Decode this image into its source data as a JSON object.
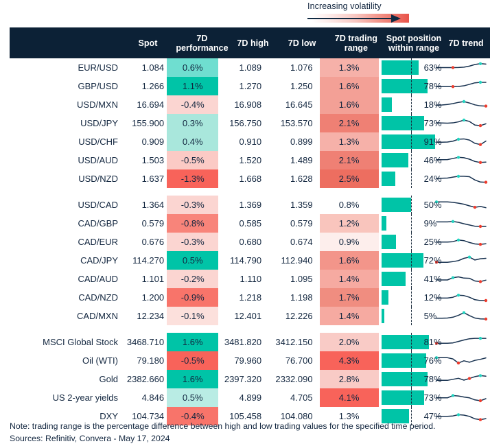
{
  "legend": {
    "volatility_label": "Increasing volatility",
    "gradient_from": "#ffffff",
    "gradient_to": "#e8544a",
    "arrow_color": "#102a43"
  },
  "header": {
    "bg": "#0c2136",
    "columns": [
      {
        "key": "label",
        "label": ""
      },
      {
        "key": "spot",
        "label": "Spot"
      },
      {
        "key": "perf",
        "label": "7D performance"
      },
      {
        "key": "high",
        "label": "7D high"
      },
      {
        "key": "low",
        "label": "7D low"
      },
      {
        "key": "range",
        "label": "7D trading range"
      },
      {
        "key": "pos",
        "label": "Spot position within range"
      },
      {
        "key": "trend",
        "label": "7D trend"
      }
    ]
  },
  "colors": {
    "positive_strong": "#00c4a7",
    "positive_mid": "#62dcc8",
    "positive_light": "#b9ece4",
    "negative_strong": "#f9635a",
    "negative_mid": "#f8a79f",
    "negative_light": "#fbd6d2",
    "negative_faint": "#fdeeec",
    "bar": "#00c4a7",
    "spark_line": "#17314f",
    "spark_high_dot": "#23d3c0",
    "spark_low_dot": "#ef3b2c",
    "text": "#12263f"
  },
  "blocks": [
    {
      "name": "usd-pairs",
      "rows": [
        {
          "label": "EUR/USD",
          "spot": "1.084",
          "perf": "0.6%",
          "perf_bg": "#6fded0",
          "high": "1.089",
          "low": "1.076",
          "range": "1.3%",
          "range_bg": "#f6b1a9",
          "pos_pct": "63%",
          "pos_value": 63,
          "spark": [
            0.5,
            0.5,
            0.5,
            0.5,
            0.49,
            0.46,
            0.36,
            0.2,
            0.12,
            0.16
          ],
          "spark_high_idx": 8,
          "spark_low_idx": 3
        },
        {
          "label": "GBP/USD",
          "spot": "1.266",
          "perf": "1.1%",
          "perf_bg": "#00c4a7",
          "high": "1.270",
          "low": "1.250",
          "range": "1.6%",
          "range_bg": "#f3a096",
          "pos_pct": "78%",
          "pos_value": 78,
          "spark": [
            0.55,
            0.55,
            0.55,
            0.55,
            0.53,
            0.47,
            0.33,
            0.18,
            0.13,
            0.13
          ],
          "spark_high_idx": 8,
          "spark_low_idx": 3
        },
        {
          "label": "USD/MXN",
          "spot": "16.694",
          "perf": "-0.4%",
          "perf_bg": "#fbd5d1",
          "high": "16.908",
          "low": "16.645",
          "range": "1.6%",
          "range_bg": "#f3a096",
          "pos_pct": "18%",
          "pos_value": 18,
          "spark": [
            0.56,
            0.53,
            0.48,
            0.4,
            0.28,
            0.2,
            0.34,
            0.52,
            0.62,
            0.64
          ],
          "spark_high_idx": 5,
          "spark_low_idx": 9
        },
        {
          "label": "USD/JPY",
          "spot": "155.900",
          "perf": "0.3%",
          "perf_bg": "#a9e7dc",
          "high": "156.750",
          "low": "153.570",
          "range": "2.1%",
          "range_bg": "#ef8074",
          "pos_pct": "73%",
          "pos_value": 73,
          "spark": [
            0.46,
            0.48,
            0.5,
            0.47,
            0.37,
            0.2,
            0.33,
            0.68,
            0.74,
            0.56
          ],
          "spark_high_idx": 5,
          "spark_low_idx": 8
        },
        {
          "label": "USD/CHF",
          "spot": "0.909",
          "perf": "0.4%",
          "perf_bg": "#a9e7dc",
          "high": "0.910",
          "low": "0.899",
          "range": "1.3%",
          "range_bg": "#f6b1a9",
          "pos_pct": "91%",
          "pos_value": 91,
          "spark": [
            0.55,
            0.55,
            0.53,
            0.45,
            0.26,
            0.23,
            0.34,
            0.66,
            0.78,
            0.44
          ],
          "spark_high_idx": 4,
          "spark_low_idx": 8
        },
        {
          "label": "USD/AUD",
          "spot": "1.503",
          "perf": "-0.5%",
          "perf_bg": "#fbcac5",
          "high": "1.520",
          "low": "1.489",
          "range": "2.1%",
          "range_bg": "#ef8074",
          "pos_pct": "46%",
          "pos_value": 46,
          "spark": [
            0.45,
            0.45,
            0.44,
            0.33,
            0.22,
            0.26,
            0.4,
            0.62,
            0.72,
            0.68
          ],
          "spark_high_idx": 4,
          "spark_low_idx": 8
        },
        {
          "label": "USD/NZD",
          "spot": "1.637",
          "perf": "-1.3%",
          "perf_bg": "#f8635a",
          "high": "1.668",
          "low": "1.628",
          "range": "2.5%",
          "range_bg": "#ed6e60",
          "pos_pct": "24%",
          "pos_value": 24,
          "spark": [
            0.46,
            0.45,
            0.43,
            0.34,
            0.26,
            0.26,
            0.3,
            0.62,
            0.82,
            0.84
          ],
          "spark_high_idx": 4,
          "spark_low_idx": 9
        }
      ]
    },
    {
      "name": "cad-pairs",
      "rows": [
        {
          "label": "USD/CAD",
          "spot": "1.364",
          "perf": "-0.3%",
          "perf_bg": "#fbd5d1",
          "high": "1.369",
          "low": "1.359",
          "range": "0.8%",
          "range_bg": "#ffffff",
          "pos_pct": "50%",
          "pos_value": 50,
          "spark": [
            0.22,
            0.22,
            0.22,
            0.26,
            0.34,
            0.44,
            0.6,
            0.74,
            0.66,
            0.78
          ],
          "spark_high_idx": 0,
          "spark_low_idx": 7
        },
        {
          "label": "CAD/GBP",
          "spot": "0.579",
          "perf": "-0.8%",
          "perf_bg": "#f8847a",
          "high": "0.585",
          "low": "0.579",
          "range": "1.2%",
          "range_bg": "#f9c5bd",
          "pos_pct": "9%",
          "pos_value": 9,
          "spark": [
            0.36,
            0.36,
            0.36,
            0.32,
            0.4,
            0.54,
            0.66,
            0.78,
            0.8,
            0.8
          ],
          "spark_high_idx": 3,
          "spark_low_idx": 8
        },
        {
          "label": "CAD/EUR",
          "spot": "0.676",
          "perf": "-0.3%",
          "perf_bg": "#fbd5d1",
          "high": "0.680",
          "low": "0.674",
          "range": "0.9%",
          "range_bg": "#fdeeec",
          "pos_pct": "25%",
          "pos_value": 25,
          "spark": [
            0.52,
            0.52,
            0.52,
            0.48,
            0.32,
            0.38,
            0.56,
            0.7,
            0.74,
            0.68
          ],
          "spark_high_idx": 4,
          "spark_low_idx": 8
        },
        {
          "label": "CAD/JPY",
          "spot": "114.270",
          "perf": "0.5%",
          "perf_bg": "#00c4a7",
          "high": "114.790",
          "low": "112.940",
          "range": "1.6%",
          "range_bg": "#f3958a",
          "pos_pct": "72%",
          "pos_value": 72,
          "spark": [
            0.68,
            0.68,
            0.68,
            0.62,
            0.52,
            0.3,
            0.18,
            0.46,
            0.34,
            0.3
          ],
          "spark_high_idx": 6,
          "spark_low_idx": 0
        },
        {
          "label": "CAD/AUD",
          "spot": "1.101",
          "perf": "-0.2%",
          "perf_bg": "#fbd5d1",
          "high": "1.110",
          "low": "1.095",
          "range": "1.4%",
          "range_bg": "#f6aaa1",
          "pos_pct": "41%",
          "pos_value": 41,
          "spark": [
            0.6,
            0.6,
            0.6,
            0.38,
            0.3,
            0.42,
            0.44,
            0.7,
            0.76,
            0.62
          ],
          "spark_high_idx": 3,
          "spark_low_idx": 8
        },
        {
          "label": "CAD/NZD",
          "spot": "1.200",
          "perf": "-0.9%",
          "perf_bg": "#f8746a",
          "high": "1.218",
          "low": "1.198",
          "range": "1.7%",
          "range_bg": "#f08d80",
          "pos_pct": "12%",
          "pos_value": 12,
          "spark": [
            0.56,
            0.56,
            0.56,
            0.48,
            0.28,
            0.32,
            0.48,
            0.72,
            0.8,
            0.8
          ],
          "spark_high_idx": 4,
          "spark_low_idx": 9
        },
        {
          "label": "CAD/MXN",
          "spot": "12.234",
          "perf": "-0.1%",
          "perf_bg": "#fce0dc",
          "high": "12.401",
          "low": "12.226",
          "range": "1.4%",
          "range_bg": "#f6aaa1",
          "pos_pct": "5%",
          "pos_value": 5,
          "spark": [
            0.72,
            0.72,
            0.7,
            0.62,
            0.44,
            0.18,
            0.46,
            0.7,
            0.78,
            0.8
          ],
          "spark_high_idx": 5,
          "spark_low_idx": 9
        }
      ]
    },
    {
      "name": "other-assets",
      "rows": [
        {
          "label": "MSCI Global Stock",
          "spot": "3468.710",
          "perf": "1.6%",
          "perf_bg": "#00c4a7",
          "high": "3481.820",
          "low": "3412.150",
          "range": "2.0%",
          "range_bg": "#f9cbc6",
          "pos_pct": "81%",
          "pos_value": 81,
          "spark": [
            0.62,
            0.62,
            0.62,
            0.58,
            0.44,
            0.3,
            0.18,
            0.14,
            0.14,
            0.14
          ],
          "spark_high_idx": 8,
          "spark_low_idx": 0
        },
        {
          "label": "Oil (WTI)",
          "spot": "79.180",
          "perf": "-0.5%",
          "perf_bg": "#f8635a",
          "high": "79.960",
          "low": "76.700",
          "range": "4.3%",
          "range_bg": "#f8635a",
          "pos_pct": "76%",
          "pos_value": 76,
          "spark": [
            0.22,
            0.22,
            0.22,
            0.34,
            0.74,
            0.52,
            0.66,
            0.48,
            0.38,
            0.24
          ],
          "spark_high_idx": 0,
          "spark_low_idx": 4
        },
        {
          "label": "Gold",
          "spot": "2382.660",
          "perf": "1.6%",
          "perf_bg": "#00c4a7",
          "high": "2397.320",
          "low": "2332.090",
          "range": "2.8%",
          "range_bg": "#f9cbc6",
          "pos_pct": "78%",
          "pos_value": 78,
          "spark": [
            0.62,
            0.62,
            0.62,
            0.52,
            0.42,
            0.6,
            0.44,
            0.26,
            0.16,
            0.22
          ],
          "spark_high_idx": 8,
          "spark_low_idx": 6
        },
        {
          "label": "US 2-year yields",
          "spot": "4.846",
          "perf": "0.5%",
          "perf_bg": "#b9ece4",
          "high": "4.899",
          "low": "4.705",
          "range": "4.1%",
          "range_bg": "#f8635a",
          "pos_pct": "73%",
          "pos_value": 73,
          "spark": [
            0.52,
            0.52,
            0.52,
            0.3,
            0.34,
            0.44,
            0.52,
            0.72,
            0.8,
            0.6
          ],
          "spark_high_idx": 3,
          "spark_low_idx": 8
        },
        {
          "label": "DXY",
          "spot": "104.734",
          "perf": "-0.4%",
          "perf_bg": "#f8746a",
          "high": "105.458",
          "low": "104.080",
          "range": "1.3%",
          "range_bg": "#ffffff",
          "pos_pct": "47%",
          "pos_value": 47,
          "spark": [
            0.52,
            0.52,
            0.52,
            0.48,
            0.36,
            0.4,
            0.52,
            0.76,
            0.84,
            0.74
          ],
          "spark_high_idx": 4,
          "spark_low_idx": 8
        }
      ]
    }
  ],
  "notes": {
    "note": "Note: trading range is the percentage difference between high and low trading values for the specified time period.",
    "sources": "Sources: Refinitiv, Convera - May 17, 2024"
  }
}
